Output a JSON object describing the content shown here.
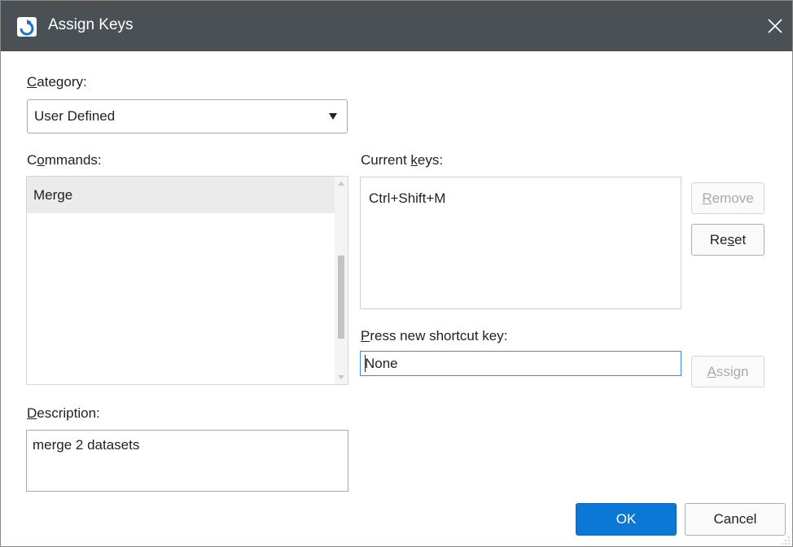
{
  "window": {
    "title": "Assign Keys",
    "app_icon": "sas-app-icon",
    "close_icon": "close-icon"
  },
  "category": {
    "label_hotkey": "C",
    "label_rest": "ategory:",
    "selected": "User Defined"
  },
  "commands": {
    "label_pre": "C",
    "label_hotkey": "o",
    "label_rest": "mmands:",
    "items": [
      "Merge"
    ]
  },
  "current_keys": {
    "label_pre": "Current ",
    "label_hotkey": "k",
    "label_rest": "eys:",
    "items": [
      "Ctrl+Shift+M"
    ]
  },
  "buttons": {
    "remove_hotkey": "R",
    "remove_rest": "emove",
    "reset_pre": "Re",
    "reset_hotkey": "s",
    "reset_rest": "et",
    "assign_hotkey": "A",
    "assign_rest": "ssign",
    "ok": "OK",
    "cancel": "Cancel"
  },
  "shortcut": {
    "label_hotkey": "P",
    "label_rest": "ress new shortcut key:",
    "value": "None"
  },
  "description": {
    "label_hotkey": "D",
    "label_rest": "escription:",
    "value": "merge 2 datasets"
  },
  "colors": {
    "titlebar": "#4b5055",
    "accent": "#0b78d6",
    "disabled_text": "#aaaaaa"
  }
}
